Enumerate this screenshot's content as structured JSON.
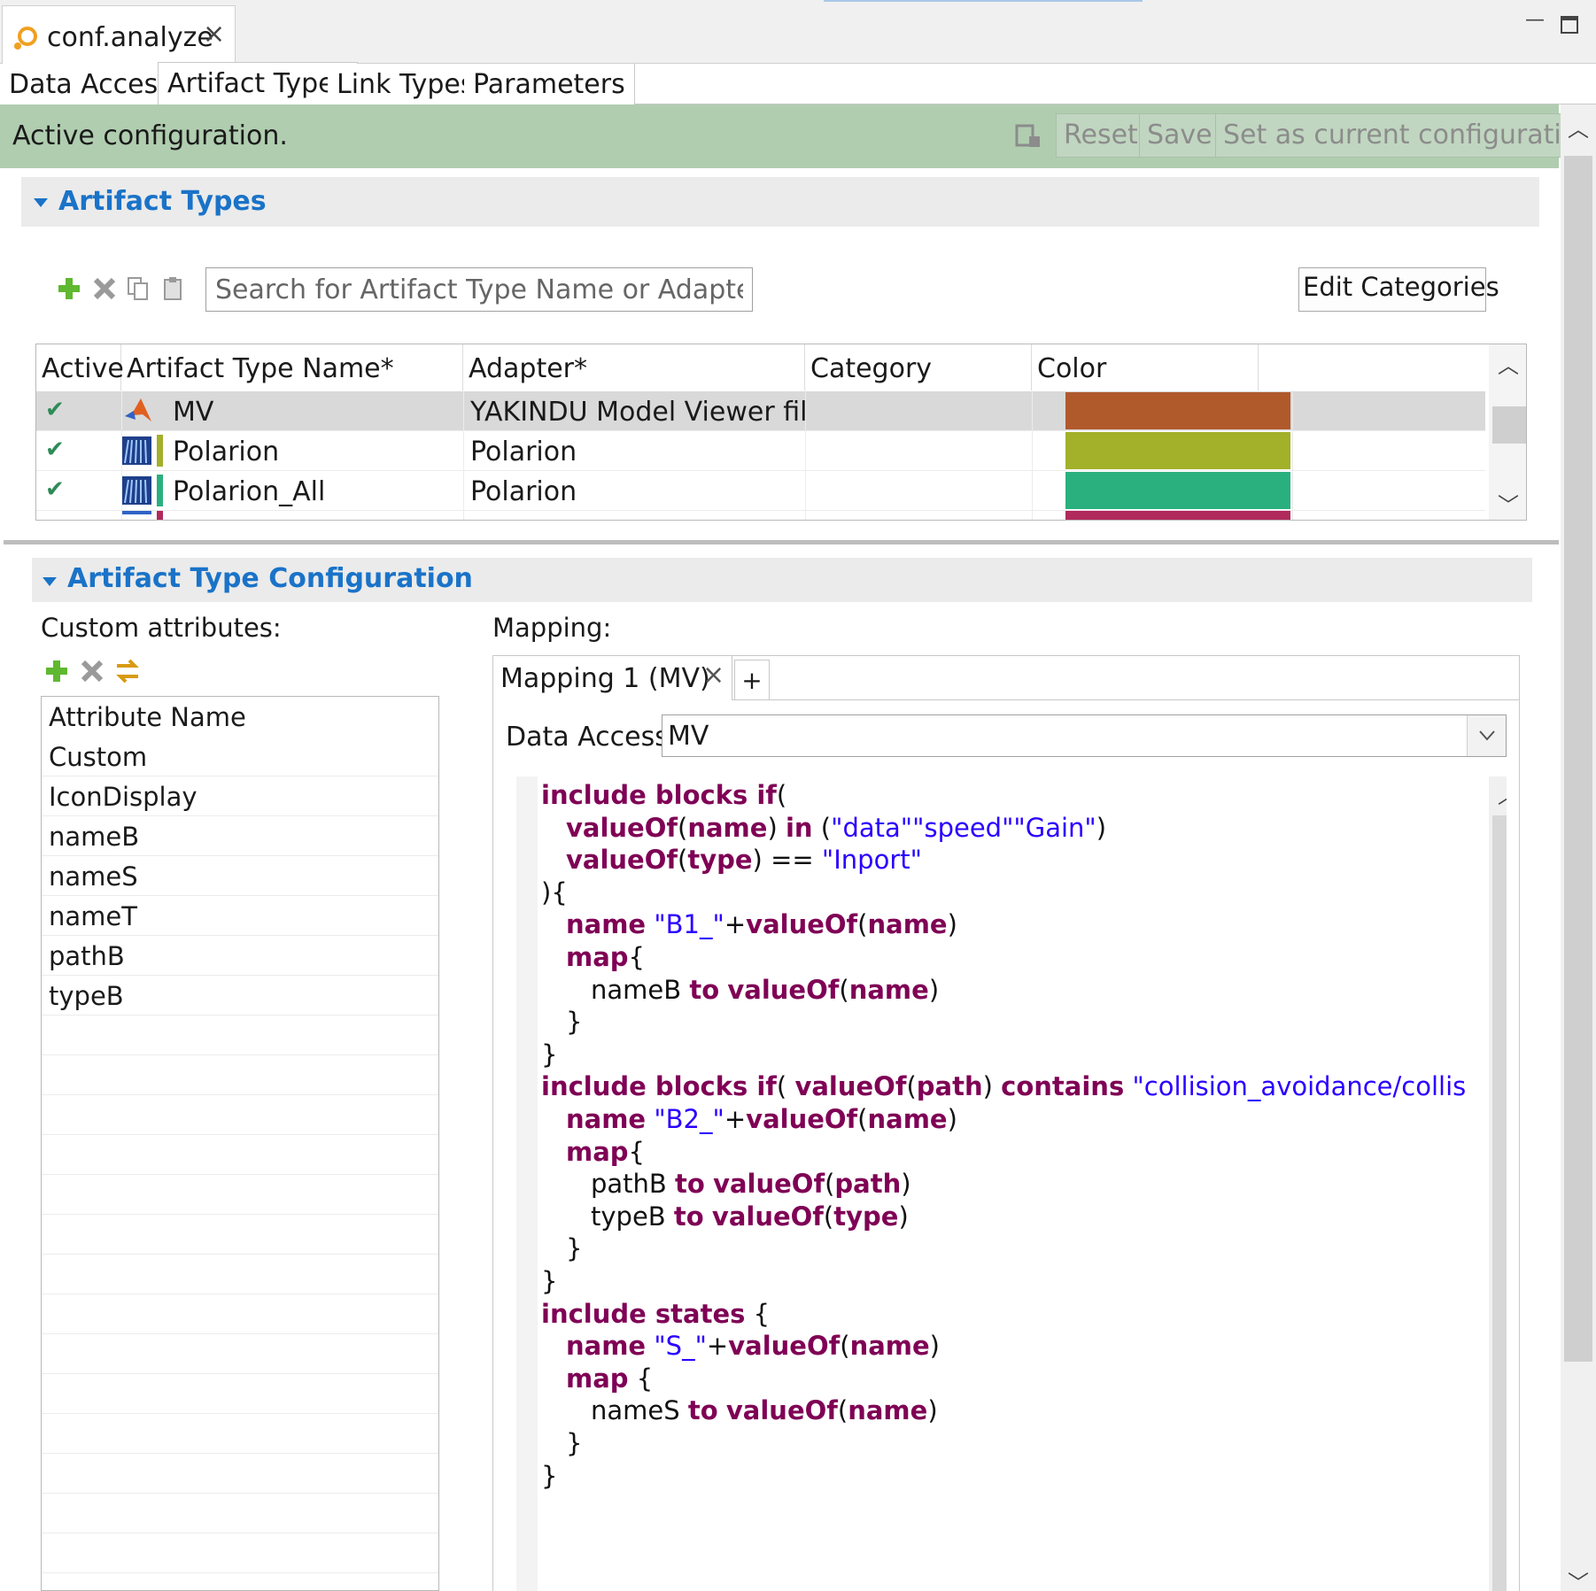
{
  "editor": {
    "tab_title": "conf.analyze",
    "close_glyph": "×"
  },
  "window": {
    "minimize_glyph": "—"
  },
  "page_tabs": [
    "Data Access",
    "Artifact Types",
    "Link Types",
    "Parameters"
  ],
  "status": {
    "text": "Active configuration.",
    "buttons": {
      "reset": "Reset",
      "save": "Save",
      "set_current": "Set as current configuration"
    }
  },
  "section_artifact_types": {
    "title": "Artifact Types",
    "search_placeholder": "Search for Artifact Type Name or Adapter...",
    "edit_categories": "Edit Categories",
    "columns": [
      "Active",
      "Artifact Type Name*",
      "Adapter*",
      "Category",
      "Color"
    ],
    "rows": [
      {
        "active": "✔",
        "name": "MV",
        "adapter": "YAKINDU Model Viewer files",
        "category": "",
        "color": "#b05a2c",
        "icon": "matlab-icon"
      },
      {
        "active": "✔",
        "name": "Polarion",
        "adapter": "Polarion",
        "category": "",
        "color": "#a2b02a",
        "icon": "polarion-icon"
      },
      {
        "active": "✔",
        "name": "Polarion_All",
        "adapter": "Polarion",
        "category": "",
        "color": "#2ab07f",
        "icon": "polarion-icon"
      }
    ],
    "partial_row_color": "#b02a5c"
  },
  "section_config": {
    "title": "Artifact Type Configuration",
    "custom_attributes_label": "Custom attributes:",
    "attribute_header": "Attribute Name",
    "attributes": [
      "Custom",
      "IconDisplay",
      "nameB",
      "nameS",
      "nameT",
      "pathB",
      "typeB"
    ],
    "mapping_label": "Mapping:",
    "mapping_tab": "Mapping 1 (MV)",
    "mapping_tab_close": "×",
    "mapping_add": "+",
    "data_access_label": "Data Access:",
    "data_access_value": "MV"
  },
  "code": [
    {
      "indent": 0,
      "parts": [
        [
          "kw",
          "include blocks if"
        ],
        [
          "t",
          "("
        ]
      ]
    },
    {
      "indent": 1,
      "parts": [
        [
          "kw",
          "valueOf"
        ],
        [
          "t",
          "("
        ],
        [
          "kw",
          "name"
        ],
        [
          "t",
          ") "
        ],
        [
          "kw",
          "in"
        ],
        [
          "t",
          " ("
        ],
        [
          "str",
          "\"data\"\"speed\"\"Gain\""
        ],
        [
          "t",
          ")"
        ]
      ]
    },
    {
      "indent": 1,
      "parts": [
        [
          "kw",
          "valueOf"
        ],
        [
          "t",
          "("
        ],
        [
          "kw",
          "type"
        ],
        [
          "t",
          ") == "
        ],
        [
          "str",
          "\"Inport\""
        ]
      ]
    },
    {
      "indent": 0,
      "parts": [
        [
          "t",
          "){"
        ]
      ]
    },
    {
      "indent": 1,
      "parts": [
        [
          "kw",
          "name"
        ],
        [
          "t",
          " "
        ],
        [
          "str",
          "\"B1_\""
        ],
        [
          "t",
          "+"
        ],
        [
          "kw",
          "valueOf"
        ],
        [
          "t",
          "("
        ],
        [
          "kw",
          "name"
        ],
        [
          "t",
          ")"
        ]
      ]
    },
    {
      "indent": 1,
      "parts": [
        [
          "kw",
          "map"
        ],
        [
          "t",
          "{"
        ]
      ]
    },
    {
      "indent": 2,
      "parts": [
        [
          "t",
          "nameB "
        ],
        [
          "kw",
          "to"
        ],
        [
          "t",
          " "
        ],
        [
          "kw",
          "valueOf"
        ],
        [
          "t",
          "("
        ],
        [
          "kw",
          "name"
        ],
        [
          "t",
          ")"
        ]
      ]
    },
    {
      "indent": 1,
      "parts": [
        [
          "t",
          "}"
        ]
      ]
    },
    {
      "indent": 0,
      "parts": [
        [
          "t",
          "}"
        ]
      ]
    },
    {
      "indent": 0,
      "parts": [
        [
          "kw",
          "include blocks if"
        ],
        [
          "t",
          "( "
        ],
        [
          "kw",
          "valueOf"
        ],
        [
          "t",
          "("
        ],
        [
          "kw",
          "path"
        ],
        [
          "t",
          ") "
        ],
        [
          "kw",
          "contains"
        ],
        [
          "t",
          " "
        ],
        [
          "str",
          "\"collision_avoidance/collision avoid"
        ]
      ]
    },
    {
      "indent": 1,
      "parts": [
        [
          "kw",
          "name"
        ],
        [
          "t",
          " "
        ],
        [
          "str",
          "\"B2_\""
        ],
        [
          "t",
          "+"
        ],
        [
          "kw",
          "valueOf"
        ],
        [
          "t",
          "("
        ],
        [
          "kw",
          "name"
        ],
        [
          "t",
          ")"
        ]
      ]
    },
    {
      "indent": 1,
      "parts": [
        [
          "kw",
          "map"
        ],
        [
          "t",
          "{"
        ]
      ]
    },
    {
      "indent": 2,
      "parts": [
        [
          "t",
          "pathB "
        ],
        [
          "kw",
          "to"
        ],
        [
          "t",
          " "
        ],
        [
          "kw",
          "valueOf"
        ],
        [
          "t",
          "("
        ],
        [
          "kw",
          "path"
        ],
        [
          "t",
          ")"
        ]
      ]
    },
    {
      "indent": 2,
      "parts": [
        [
          "t",
          "typeB "
        ],
        [
          "kw",
          "to"
        ],
        [
          "t",
          " "
        ],
        [
          "kw",
          "valueOf"
        ],
        [
          "t",
          "("
        ],
        [
          "kw",
          "type"
        ],
        [
          "t",
          ")"
        ]
      ]
    },
    {
      "indent": 1,
      "parts": [
        [
          "t",
          "}"
        ]
      ]
    },
    {
      "indent": 0,
      "parts": [
        [
          "t",
          "}"
        ]
      ]
    },
    {
      "indent": 0,
      "parts": [
        [
          "kw",
          "include states"
        ],
        [
          "t",
          " {"
        ]
      ]
    },
    {
      "indent": 1,
      "parts": [
        [
          "kw",
          "name"
        ],
        [
          "t",
          " "
        ],
        [
          "str",
          "\"S_\""
        ],
        [
          "t",
          "+"
        ],
        [
          "kw",
          "valueOf"
        ],
        [
          "t",
          "("
        ],
        [
          "kw",
          "name"
        ],
        [
          "t",
          ")"
        ]
      ]
    },
    {
      "indent": 1,
      "parts": [
        [
          "kw",
          "map"
        ],
        [
          "t",
          " {"
        ]
      ]
    },
    {
      "indent": 2,
      "parts": [
        [
          "t",
          "nameS "
        ],
        [
          "kw",
          "to"
        ],
        [
          "t",
          " "
        ],
        [
          "kw",
          "valueOf"
        ],
        [
          "t",
          "("
        ],
        [
          "kw",
          "name"
        ],
        [
          "t",
          ")"
        ]
      ]
    },
    {
      "indent": 1,
      "parts": [
        [
          "t",
          "}"
        ]
      ]
    },
    {
      "indent": 0,
      "parts": [
        [
          "t",
          "}"
        ]
      ]
    }
  ]
}
